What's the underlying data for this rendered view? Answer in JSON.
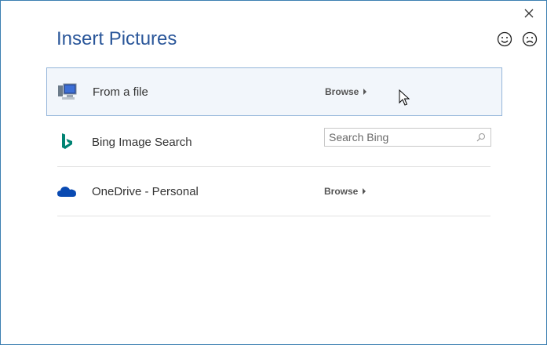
{
  "dialog": {
    "title": "Insert Pictures",
    "close_icon": "close-icon",
    "feedback": {
      "smile_icon": "smile-icon",
      "frown_icon": "frown-icon"
    }
  },
  "sources": [
    {
      "label": "From a file",
      "icon": "computer-icon",
      "action": "Browse"
    },
    {
      "label": "Bing Image Search",
      "icon": "bing-icon",
      "search_placeholder": "Search Bing"
    },
    {
      "label": "OneDrive - Personal",
      "icon": "onedrive-cloud-icon",
      "action": "Browse"
    }
  ],
  "colors": {
    "title": "#2b579a",
    "bing": "#008373",
    "onedrive": "#094ab2",
    "selected_bg": "#f2f6fb",
    "selected_border": "#94b5da"
  }
}
